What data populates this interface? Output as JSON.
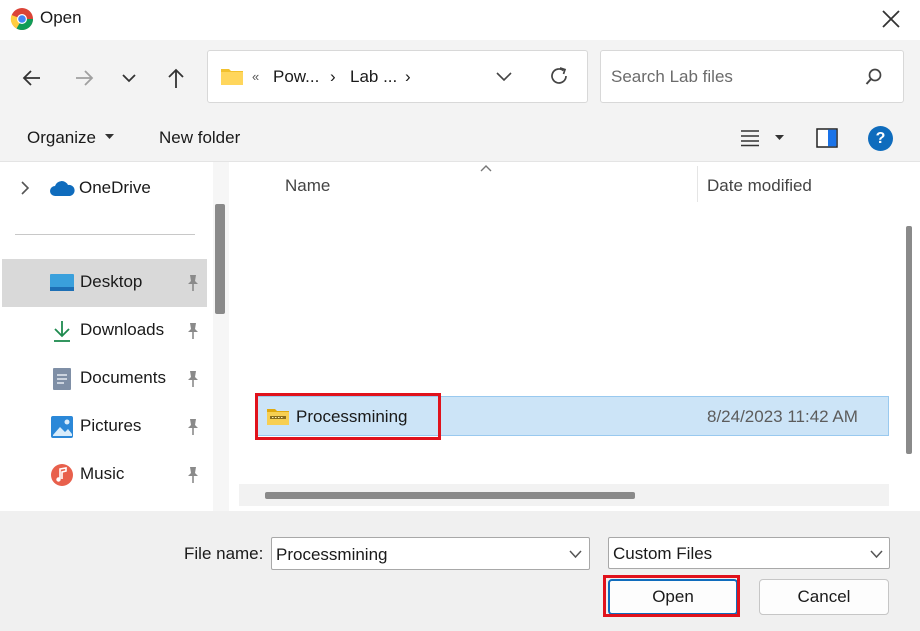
{
  "window": {
    "title": "Open",
    "close_glyph": "✕"
  },
  "nav": {
    "back_glyph": "←",
    "forward_glyph": "→",
    "recent_glyph": "⌄",
    "up_glyph": "↑"
  },
  "address": {
    "overflow": "«",
    "crumb1": "Pow...",
    "crumb2": "Lab ...",
    "sep": "›"
  },
  "search": {
    "placeholder": "Search Lab files"
  },
  "toolbar": {
    "organize": "Organize",
    "new_folder": "New folder",
    "help": "?"
  },
  "sidebar": {
    "onedrive": "OneDrive",
    "items": [
      {
        "label": "Desktop",
        "icon": "desktop-icon"
      },
      {
        "label": "Downloads",
        "icon": "downloads-icon"
      },
      {
        "label": "Documents",
        "icon": "documents-icon"
      },
      {
        "label": "Pictures",
        "icon": "pictures-icon"
      },
      {
        "label": "Music",
        "icon": "music-icon"
      }
    ]
  },
  "files": {
    "columns": [
      "Name",
      "Date modified"
    ],
    "rows": [
      {
        "name": "Processmining",
        "date": "8/24/2023 11:42 AM",
        "type": "zip-folder"
      }
    ]
  },
  "footer": {
    "filename_label": "File name:",
    "filename_value": "Processmining",
    "filetype_value": "Custom Files",
    "open_label": "Open",
    "cancel_label": "Cancel"
  },
  "colors": {
    "highlight_red": "#e0121c",
    "selection_blue": "#cce4f7",
    "help_blue": "#0f6cbd"
  }
}
